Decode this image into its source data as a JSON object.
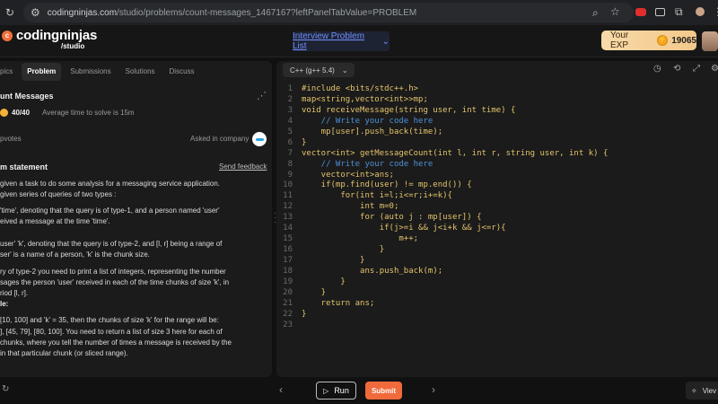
{
  "browser": {
    "url_host": "codingninjas.com",
    "url_path": "/studio/problems/count-messages_1467167?leftPanelTabValue=PROBLEM"
  },
  "header": {
    "logo_text": "codingninjas",
    "logo_sub": "/studio",
    "problem_list_label": "Interview Problem List",
    "exp_label": "Your EXP",
    "exp_value": "19065"
  },
  "left_panel": {
    "tabs": [
      {
        "label": "pics"
      },
      {
        "label": "Problem"
      },
      {
        "label": "Submissions"
      },
      {
        "label": "Solutions"
      },
      {
        "label": "Discuss"
      }
    ],
    "title": "unt Messages",
    "score": "40/40",
    "avg_time": "Average time to solve is 15m",
    "upvotes": "pvotes",
    "asked_in": "Asked in company",
    "statement_heading": "m statement",
    "send_feedback": "Send feedback",
    "statement_lines": [
      "given a task to do some analysis for a messaging service application.",
      "given series of queries of two types :",
      "'time', denoting that the query is of type-1, and a person named 'user'",
      "eived a message at the time 'time'.",
      "",
      "user' 'k', denoting that the query is of type-2, and [l, r] being a range of",
      "ser' is a name of a person, 'k' is the chunk size.",
      "ry of type-2 you need to print a list of integers, representing the number",
      "sages the person 'user' received in each of the time chunks of size 'k', in",
      "riod [l, r].",
      "le:",
      "[10, 100] and 'k' = 35, then the chunks of size 'k' for the range will be:",
      "], [45, 79], [80, 100]. You need to return a list of size 3 here for each of",
      "chunks, where you tell the number of times a message is received by the",
      "in that particular chunk (or sliced range)."
    ]
  },
  "editor": {
    "language": "C++ (g++ 5.4)",
    "lines": [
      "#include <bits/stdc++.h>",
      "map<string,vector<int>>mp;",
      "void receiveMessage(string user, int time) {",
      "    // Write your code here",
      "    mp[user].push_back(time);",
      "}",
      "vector<int> getMessageCount(int l, int r, string user, int k) {",
      "    // Write your code here",
      "    vector<int>ans;",
      "    if(mp.find(user) != mp.end()) {",
      "        for(int i=l;i<=r;i+=k){",
      "            int m=0;",
      "            for (auto j : mp[user]) {",
      "                if(j>=i && j<i+k && j<=r){",
      "                    m++;",
      "                }",
      "            }",
      "            ans.push_back(m);",
      "        }",
      "    }",
      "    return ans;",
      "}",
      ""
    ]
  },
  "bottom_bar": {
    "run_label": "Run",
    "submit_label": "Submit",
    "view_label": "Viev"
  },
  "colors": {
    "accent": "#f06a3b",
    "code": "#e4c36b",
    "link": "#6f8fff"
  }
}
